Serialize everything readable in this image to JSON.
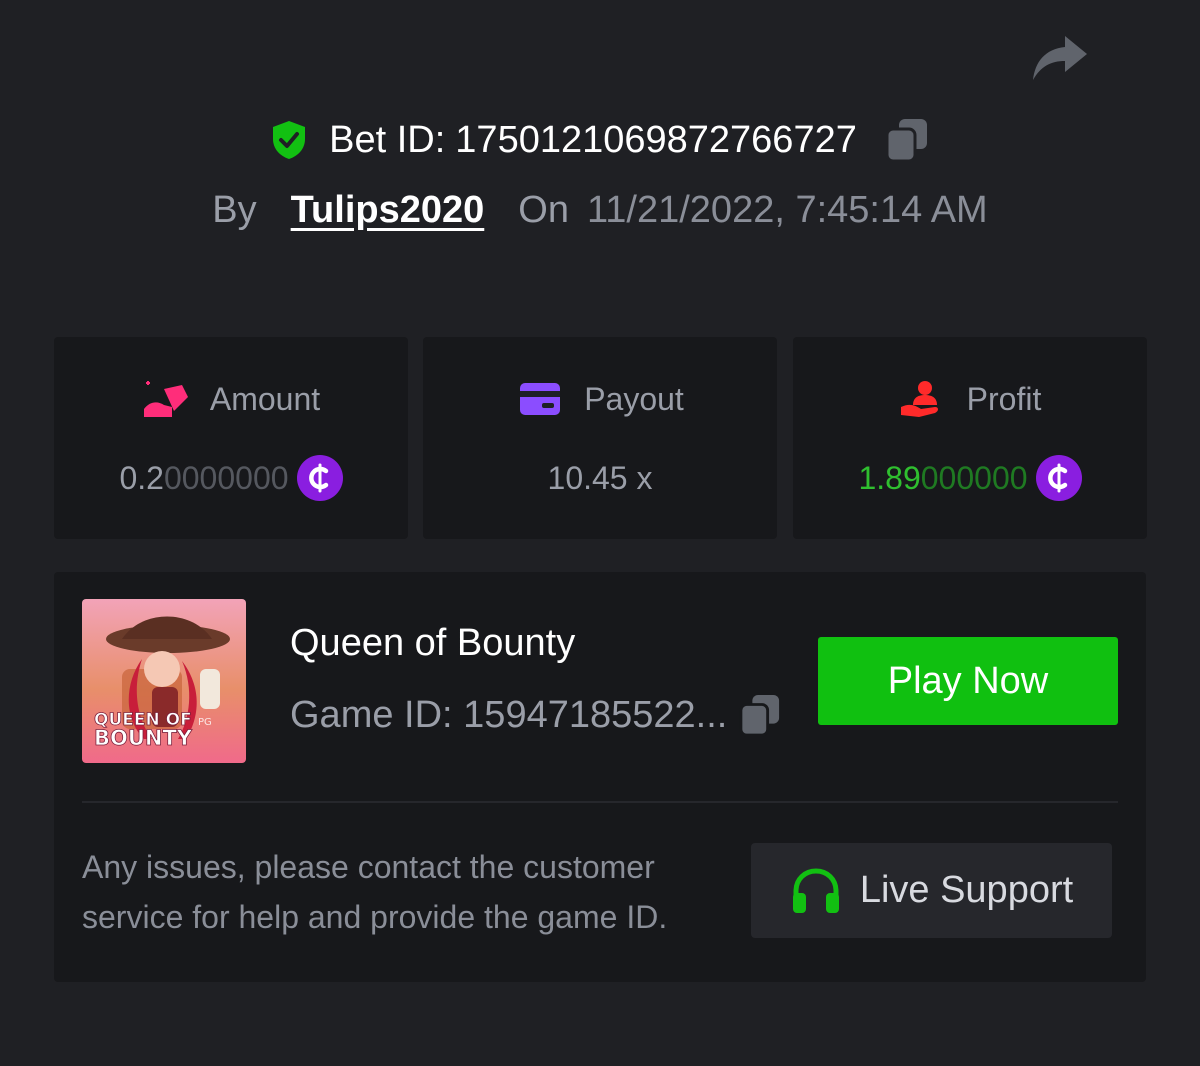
{
  "bet": {
    "label": "Bet ID:",
    "id": "1750121069872766727"
  },
  "meta": {
    "by_label": "By",
    "username": "Tulips2020",
    "on_label": "On",
    "datetime": "11/21/2022, 7:45:14 AM"
  },
  "stats": {
    "amount": {
      "label": "Amount",
      "value_main": "0.2",
      "value_dim": "0000000",
      "icon": "gem-hand-icon"
    },
    "payout": {
      "label": "Payout",
      "value": "10.45 x",
      "icon": "card-icon"
    },
    "profit": {
      "label": "Profit",
      "value_main": "1.89",
      "value_dim": "000000",
      "icon": "profit-hand-icon"
    },
    "currency_symbol": "₵"
  },
  "game": {
    "title": "Queen of Bounty",
    "id_label": "Game ID:",
    "id_value": "15947185522...",
    "thumb_line1": "QUEEN OF",
    "thumb_line2": "BOUNTY",
    "thumb_badge": "PG",
    "play_label": "Play Now"
  },
  "support": {
    "help_text": "Any issues, please contact the customer service for help and provide the game ID.",
    "button_label": "Live Support"
  },
  "colors": {
    "background": "#1f2024",
    "panel": "#17181b",
    "accent_green": "#10c010",
    "coin_purple": "#8a1ee0",
    "profit_green": "#2fbf2f"
  }
}
